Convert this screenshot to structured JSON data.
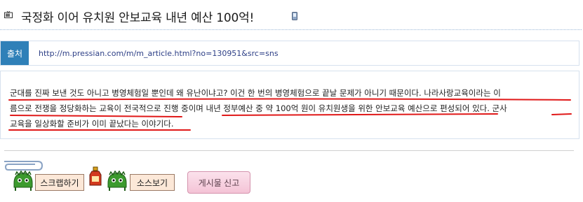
{
  "article": {
    "title": "국정화 이어 유치원 안보교육 내년 예산 100억!"
  },
  "source": {
    "label": "출처",
    "url": "http://m.pressian.com/m/m_article.html?no=130951&src=sns"
  },
  "content": {
    "lines": [
      "군대를 진짜 보낸 것도 아니고 병영체험일 뿐인데 왜 유난이냐고? 이건 한 번의 병영체험으로 끝날 문제가 아니기 때문이다. 나라사랑교육이라는 이",
      "름으로 전쟁을 정당화하는 교육이 전국적으로 진행 중이며 내년 정부예산 중 약 100억 원이 유치원생을 위한 안보교육 예산으로 편성되어 있다. 군사",
      "교육을 일상화할 준비가 이미 끝났다는 이야기다."
    ]
  },
  "actions": {
    "scrap_label": "스크랩하기",
    "view_source_label": "소스보기",
    "report_label": "게시물 신고"
  },
  "colors": {
    "source_label_bg": "#2f80b8",
    "underline": "#e01818",
    "report_button": "#f4c3d6"
  },
  "icons": {
    "title": "tv-icon",
    "title_tail": "mobile-icon",
    "clip": "paperclip-icon",
    "mascot": "green-mascot-icon",
    "bottle": "bottle-icon"
  }
}
